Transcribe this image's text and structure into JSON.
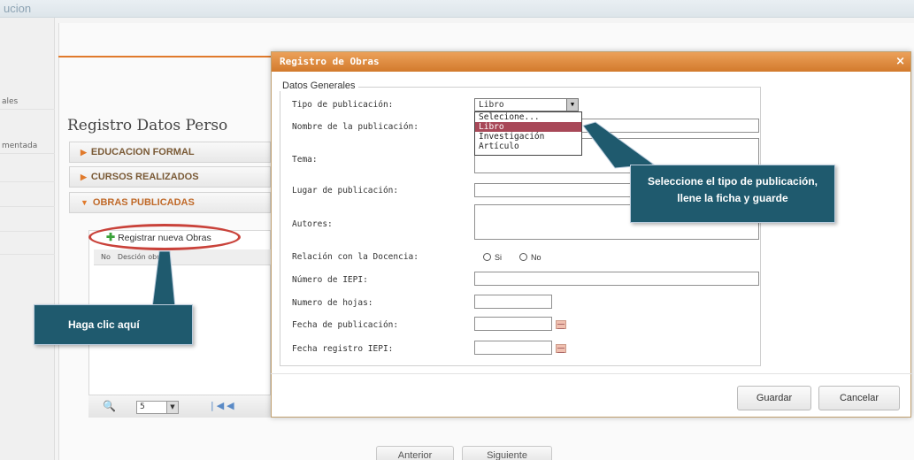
{
  "header": {
    "brand": "ucion"
  },
  "leftnav": {
    "items": [
      "ales",
      "mentada",
      "",
      "",
      "",
      ""
    ]
  },
  "page": {
    "title": "Registro Datos Perso",
    "sections": [
      {
        "label": "EDUCACION FORMAL"
      },
      {
        "label": "CURSOS REALIZADOS"
      },
      {
        "label": "OBRAS PUBLICADAS"
      }
    ],
    "register_button": "Registrar nueva Obras",
    "grid_columns": [
      "No",
      "Desc",
      "ión obra"
    ],
    "pager": {
      "page_size": "5"
    },
    "buttons": {
      "prev": "Anterior",
      "next": "Siguiente"
    }
  },
  "modal": {
    "title": "Registro de Obras",
    "close": "×",
    "legend": "Datos Generales",
    "fields": {
      "tipo": {
        "label": "Tipo de publicación:",
        "value": "Libro"
      },
      "nombre": {
        "label": "Nombre de la publicación:"
      },
      "tema": {
        "label": "Tema:"
      },
      "lugar": {
        "label": "Lugar de publicación:"
      },
      "autores": {
        "label": "Autores:"
      },
      "relacion": {
        "label": "Relación con la Docencia:",
        "options": [
          "Si",
          "No"
        ]
      },
      "iepi": {
        "label": "Número de IEPI:"
      },
      "hojas": {
        "label": "Numero de hojas:"
      },
      "fecha_pub": {
        "label": "Fecha de publicación:"
      },
      "fecha_iepi": {
        "label": "Fecha registro IEPI:"
      }
    },
    "dropdown_options": [
      "Selecione...",
      "Libro",
      "Investigación",
      "Artículo"
    ],
    "save": "Guardar",
    "cancel": "Cancelar"
  },
  "callouts": {
    "select_type": "Seleccione el tipo de publicación, llene la ficha y guarde",
    "click_here": "Haga clic aquí"
  },
  "colors": {
    "accent": "#d27a2c",
    "callout": "#1f5a6e",
    "highlight": "#c9423a"
  },
  "icons": [
    "plus-icon",
    "close-icon",
    "calendar-icon",
    "chevron-down-icon",
    "search-icon",
    "first-page-icon",
    "prev-page-icon"
  ]
}
